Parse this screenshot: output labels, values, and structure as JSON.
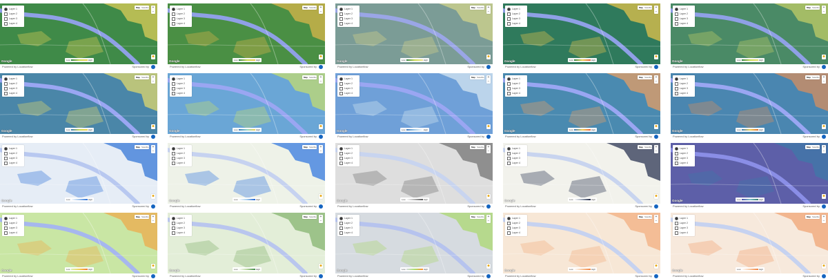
{
  "layers_panel": {
    "items": [
      {
        "label": "Layer 1"
      },
      {
        "label": "Layer 2"
      },
      {
        "label": "Layer 3"
      },
      {
        "label": "Layer 4"
      }
    ]
  },
  "map_type": {
    "map_label": "Map",
    "satellite_label": "Satellite"
  },
  "zoom": {
    "in_label": "+",
    "out_label": "−"
  },
  "legend": {
    "low_label": "Low",
    "high_label": "High"
  },
  "attribution": {
    "google_label": "Google",
    "powered_label": "Powered by Locationflow",
    "sponsored_label": "Sponsored by"
  },
  "icons": {
    "pegman": "pegman-icon",
    "sponsor": "sponsor-logo-icon"
  },
  "panels": [
    {
      "base": "#3f8a48",
      "grad": [
        "#2f7f44",
        "#c8d84e",
        "#f0d050"
      ],
      "hot": "#e8d25a",
      "road": "#8fa0e6"
    },
    {
      "base": "#4a8f44",
      "grad": [
        "#2f7f44",
        "#c8d84e",
        "#f0c24a"
      ],
      "hot": "#e2b84a",
      "road": "#8fa0e6"
    },
    {
      "base": "#7b9c96",
      "grad": [
        "#2f7f44",
        "#c8d84e",
        "#f0e38e"
      ],
      "hot": "#d9d88a",
      "road": "#9aa6e6"
    },
    {
      "base": "#2f7a5c",
      "grad": [
        "#2f7f44",
        "#f0d050",
        "#e85a3a"
      ],
      "hot": "#f0c84a",
      "road": "#8fa0e6"
    },
    {
      "base": "#4a8a66",
      "grad": [
        "#2f7f44",
        "#c8d84e",
        "#e8e06a"
      ],
      "hot": "#c9d266",
      "road": "#8fa0e6"
    },
    {
      "base": "#4a86a8",
      "grad": [
        "#3d78b8",
        "#c8d84e",
        "#f0d050"
      ],
      "hot": "#e8dd6a",
      "road": "#9aa6f2"
    },
    {
      "base": "#6aa6d6",
      "grad": [
        "#3d78b8",
        "#8fd2c8",
        "#f0d050"
      ],
      "hot": "#c9e06a",
      "road": "#9aa6f2"
    },
    {
      "base": "#6fa0d8",
      "grad": [
        "#3d78b8",
        "#9fcae6",
        "#ffffff"
      ],
      "hot": "#dbeaf4",
      "road": "#9aa6f2"
    },
    {
      "base": "#4a8ab0",
      "grad": [
        "#3d78b8",
        "#f0d050",
        "#e85a3a"
      ],
      "hot": "#f1a060",
      "road": "#9aa6f2"
    },
    {
      "base": "#4a86b0",
      "grad": [
        "#3d78b8",
        "#f0d050",
        "#d96a30"
      ],
      "hot": "#df8e5a",
      "road": "#9aa6f2"
    },
    {
      "base": "#e6edf6",
      "grad": [
        "#ffffff",
        "#9fc2ea",
        "#2a6fd6"
      ],
      "hot": "#2a6fd6",
      "road": "#b8c8f0"
    },
    {
      "base": "#eef2e8",
      "grad": [
        "#ffffff",
        "#a8cdea",
        "#1e62d0"
      ],
      "hot": "#2a72e0",
      "road": "#c6d2f0"
    },
    {
      "base": "#dedede",
      "grad": [
        "#ffffff",
        "#b0b0b0",
        "#555555"
      ],
      "hot": "#6e6e6e",
      "road": "#c8d4ef"
    },
    {
      "base": "#f2f2ec",
      "grad": [
        "#ffffff",
        "#9aa4b4",
        "#1b2340"
      ],
      "hot": "#202a4a",
      "road": "#c8d4ef"
    },
    {
      "base": "#5d5fa8",
      "grad": [
        "#4a4ea8",
        "#7fbfc8",
        "#2f7a6a"
      ],
      "hot": "#3d7aa8",
      "road": "#8a8ee6"
    },
    {
      "base": "#c9e6a4",
      "grad": [
        "#d8f0b4",
        "#f0d050",
        "#f0762e"
      ],
      "hot": "#f0a646",
      "road": "#a6b7ee"
    },
    {
      "base": "#e3eed8",
      "grad": [
        "#ffffff",
        "#b6d49a",
        "#3f8a48"
      ],
      "hot": "#7fb06a",
      "road": "#b9c6ee"
    },
    {
      "base": "#d6dbe0",
      "grad": [
        "#d6dbe0",
        "#a8e06a",
        "#ff8c2e"
      ],
      "hot": "#a8d86a",
      "road": "#b6c3ee"
    },
    {
      "base": "#f7e7d6",
      "grad": [
        "#ffffff",
        "#f6c49a",
        "#f07f3a"
      ],
      "hot": "#f2ab7a",
      "road": "#c6d2f0"
    },
    {
      "base": "#f7e9dc",
      "grad": [
        "#ffffff",
        "#f7c7a1",
        "#f07f3a"
      ],
      "hot": "#f0a06e",
      "road": "#c6d2f0"
    }
  ]
}
